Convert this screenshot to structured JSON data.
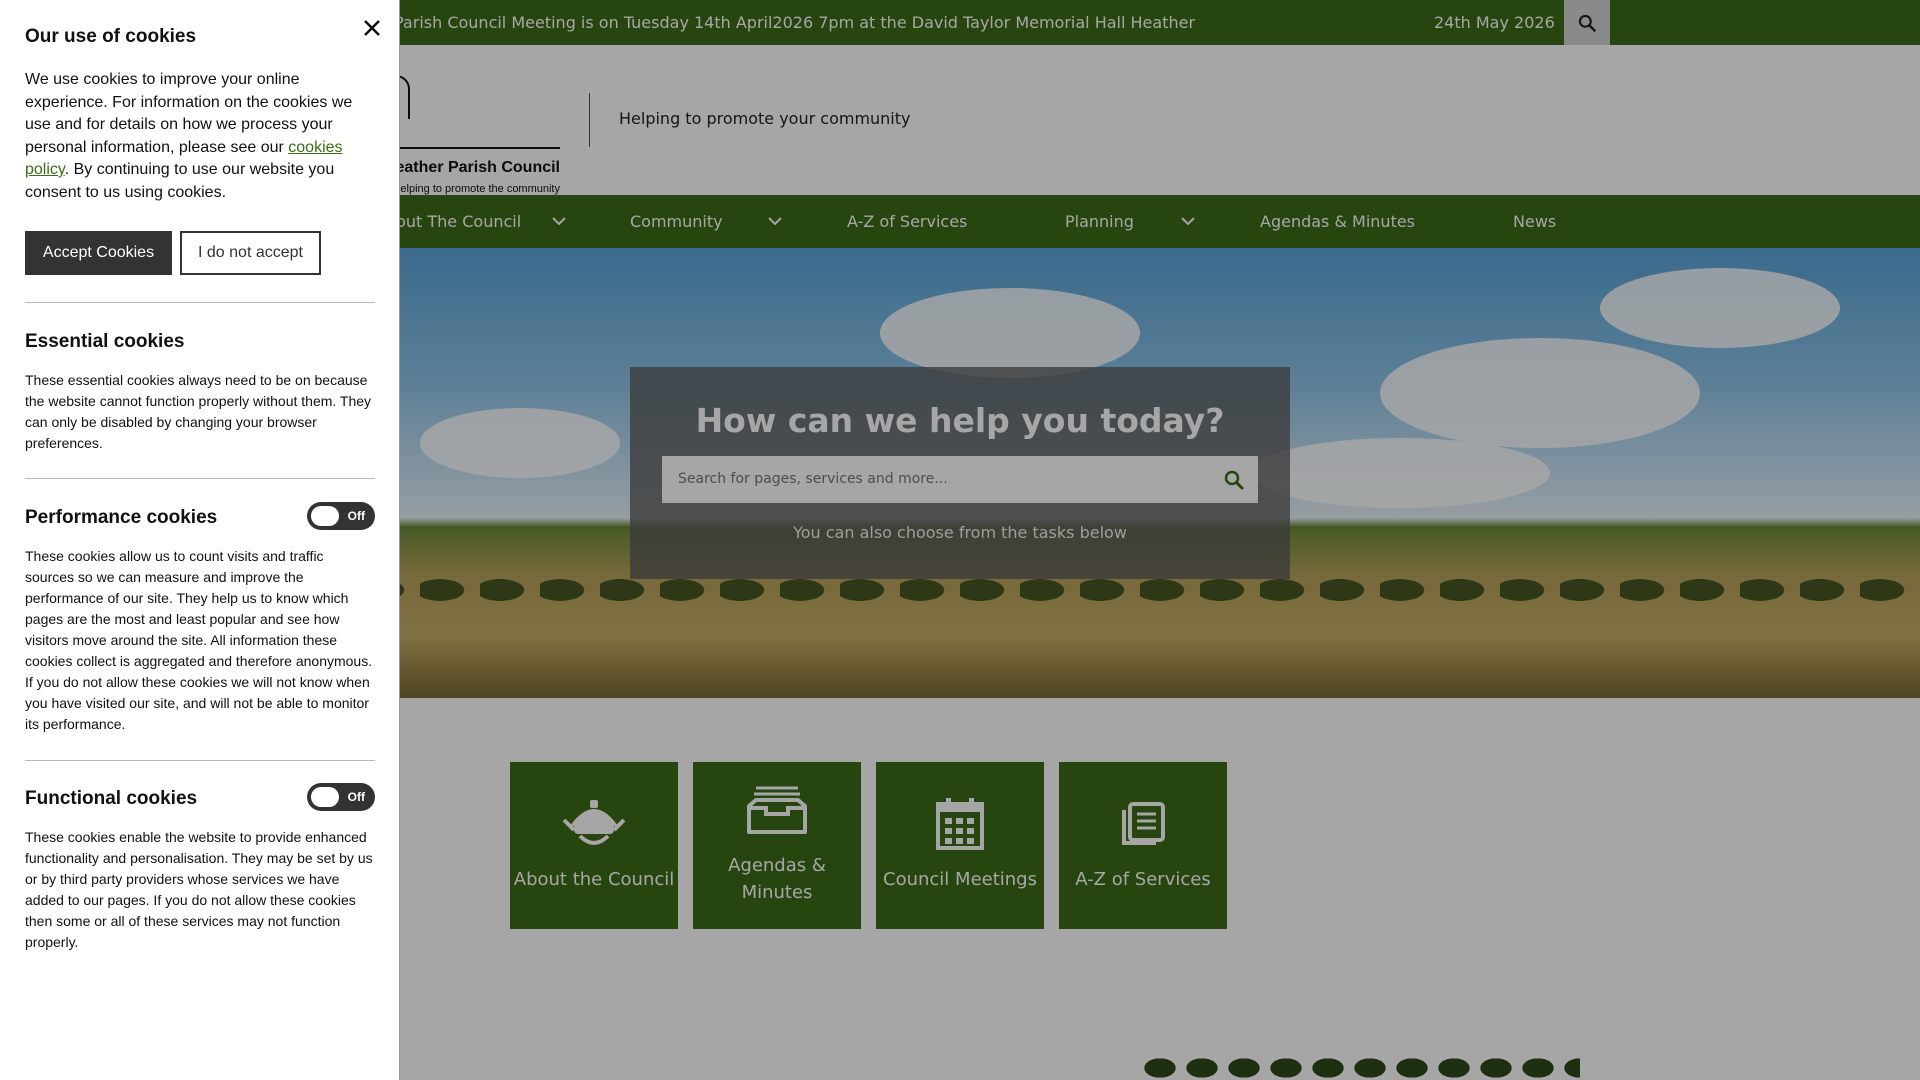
{
  "topbar": {
    "ticker": "Parish Council Meeting is on Tuesday 14th April2026 7pm at the David Taylor Memorial Hall Heather",
    "date": "24th May 2026",
    "search_icon": "search-icon"
  },
  "header": {
    "logo_name": "Heather Parish Council",
    "logo_tag": "Helping to promote the community",
    "strapline": "Helping to promote your community"
  },
  "nav": {
    "items": [
      {
        "label": "About The Council",
        "has_dropdown": true
      },
      {
        "label": "Community",
        "has_dropdown": true
      },
      {
        "label": "A-Z of Services",
        "has_dropdown": false
      },
      {
        "label": "Planning",
        "has_dropdown": true
      },
      {
        "label": "Agendas & Minutes",
        "has_dropdown": false
      },
      {
        "label": "News",
        "has_dropdown": false
      }
    ]
  },
  "hero": {
    "title": "How can we help you today?",
    "search_placeholder": "Search for pages, services and more...",
    "subtitle": "You can also choose from the tasks below"
  },
  "tiles": [
    {
      "label": "About the Council",
      "icon": "council-crest-icon"
    },
    {
      "label": "Agendas & Minutes",
      "icon": "inbox-tray-icon"
    },
    {
      "label": "Council Meetings",
      "icon": "calendar-icon"
    },
    {
      "label": "A-Z of Services",
      "icon": "document-list-icon"
    }
  ],
  "cookies": {
    "title": "Our use of cookies",
    "intro_before": "We use cookies to improve your online experience. For information on the cookies we use and for details on how we process your personal information, please see our ",
    "intro_link": "cookies policy",
    "intro_after": ". By continuing to use our website you consent to us using cookies.",
    "accept_label": "Accept Cookies",
    "decline_label": "I do not accept",
    "essential": {
      "title": "Essential cookies",
      "desc": "These essential cookies always need to be on because the website cannot function properly without them. They can only be disabled by changing your browser preferences."
    },
    "performance": {
      "title": "Performance cookies",
      "toggle": "Off",
      "desc": "These cookies allow us to count visits and traffic sources so we can measure and improve the performance of our site. They help us to know which pages are the most and least popular and see how visitors move around the site. All information these cookies collect is aggregated and therefore anonymous. If you do not allow these cookies we will not know when you have visited our site, and will not be able to monitor its performance."
    },
    "functional": {
      "title": "Functional cookies",
      "toggle": "Off",
      "desc": "These cookies enable the website to provide enhanced functionality and personalisation. They may be set by us or by third party providers whose services we have added to our pages. If you do not allow these cookies then some or all of these services may not function properly."
    }
  },
  "colors": {
    "brand_green": "#3d6b16",
    "dark_button": "#333333",
    "overlay": "rgba(0,0,0,0.35)"
  }
}
